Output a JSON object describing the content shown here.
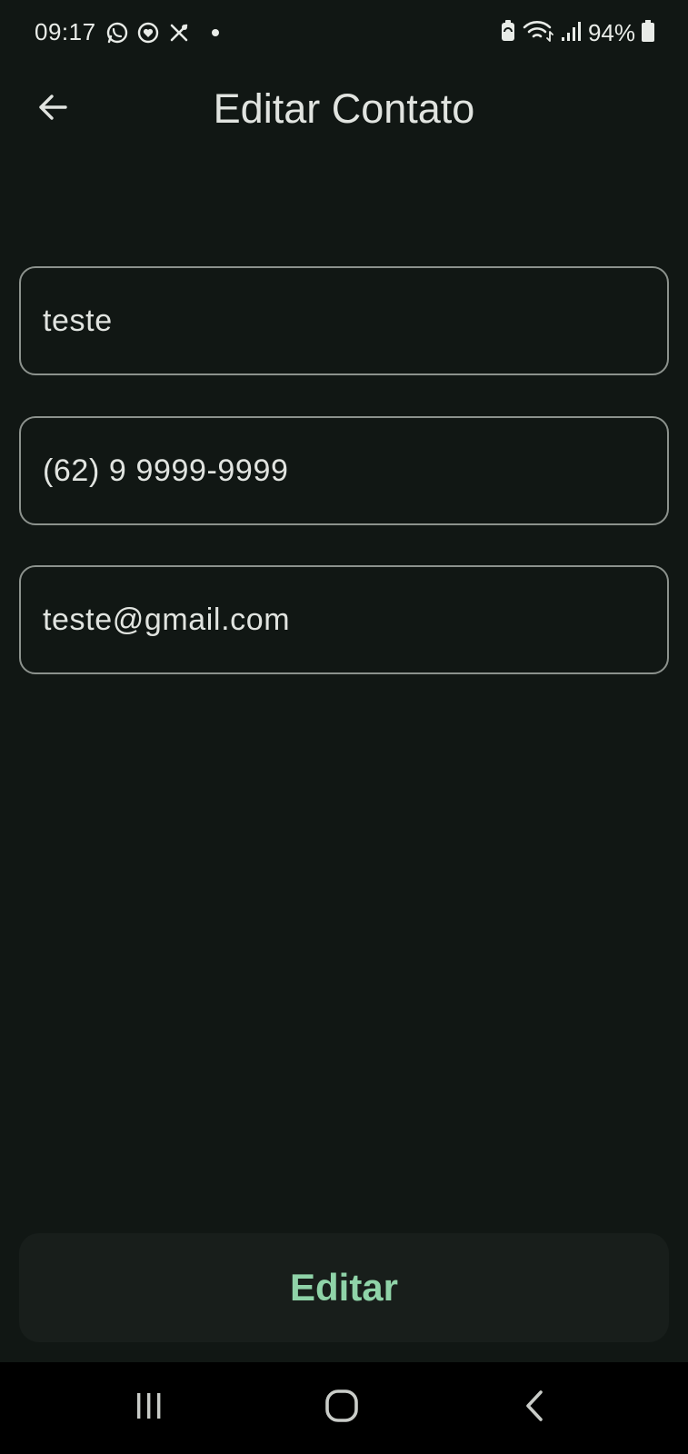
{
  "status_bar": {
    "time": "09:17",
    "battery": "94%",
    "left_icons": [
      "whatsapp-icon",
      "shield-heart-icon",
      "tools-icon",
      "dot-icon"
    ],
    "right_icons": [
      "battery-saver-icon",
      "wifi-icon",
      "signal-icon",
      "battery-icon"
    ]
  },
  "app_bar": {
    "title": "Editar Contato",
    "back_icon": "arrow-left-icon"
  },
  "form": {
    "name_value": "teste",
    "phone_value": "(62) 9 9999-9999",
    "email_value": "teste@gmail.com"
  },
  "actions": {
    "submit_label": "Editar"
  },
  "nav_bar": {
    "icons": [
      "recent-apps-icon",
      "home-icon",
      "back-icon"
    ]
  },
  "colors": {
    "background": "#111714",
    "field_border": "#8c928d",
    "text": "#e1e4e0",
    "accent": "#8fd3a8",
    "button_surface": "#181e1b",
    "nav_background": "#000000"
  }
}
